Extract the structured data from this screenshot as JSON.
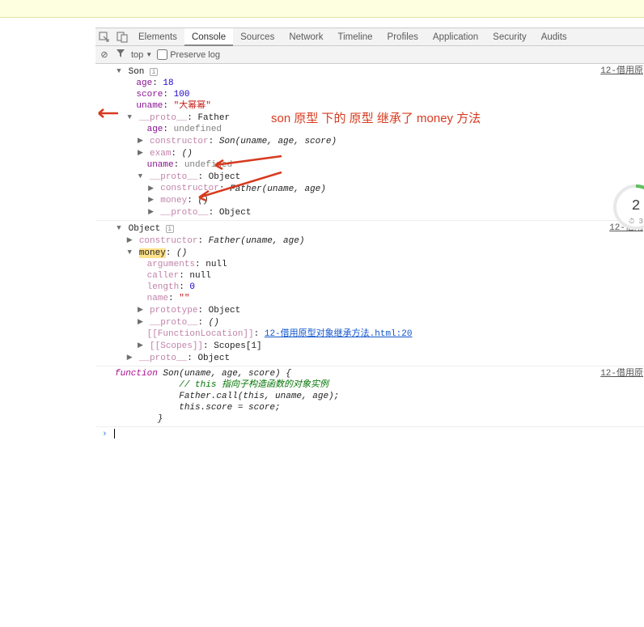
{
  "topbar": {},
  "tabs": {
    "inspect_icon": "inspect",
    "device_icon": "device",
    "items": [
      "Elements",
      "Console",
      "Sources",
      "Network",
      "Timeline",
      "Profiles",
      "Application",
      "Security",
      "Audits"
    ],
    "active": "Console"
  },
  "filterbar": {
    "clear_icon": "⊘",
    "context": "top",
    "preserve_label": "Preserve log"
  },
  "annotation": {
    "text": "son   原型 下的 原型 继承了   money 方法"
  },
  "entries": [
    {
      "srclink": "12-借用原",
      "tree": {
        "root": "Son",
        "lines": [
          {
            "indent": 1,
            "arrow": "down",
            "prop": "",
            "text": "Son",
            "trail": ""
          },
          {
            "indent": 2,
            "prop": "age",
            "val_num": "18"
          },
          {
            "indent": 2,
            "prop": "score",
            "val_num": "100"
          },
          {
            "indent": 2,
            "prop": "uname",
            "val_str": "\"大幂幂\""
          },
          {
            "indent": 2,
            "arrow": "down",
            "prop_f": "__proto__",
            "val_obj": "Father"
          },
          {
            "indent": 3,
            "prop": "age",
            "val_undef": "undefined"
          },
          {
            "indent": 3,
            "arrow": "right",
            "prop_f": "constructor",
            "val_fn": "Son(uname, age, score)"
          },
          {
            "indent": 3,
            "arrow": "right",
            "prop_f": "exam",
            "val_fn": "()"
          },
          {
            "indent": 3,
            "prop": "uname",
            "val_undef": "undefined"
          },
          {
            "indent": 3,
            "arrow": "down",
            "prop_f": "__proto__",
            "val_obj": "Object"
          },
          {
            "indent": 4,
            "arrow": "right",
            "prop_f": "constructor",
            "val_fn": "Father(uname, age)"
          },
          {
            "indent": 4,
            "arrow": "right",
            "prop_f": "money",
            "val_fn": "()"
          },
          {
            "indent": 4,
            "arrow": "right",
            "prop_f": "__proto__",
            "val_obj": "Object"
          }
        ]
      }
    },
    {
      "srclink": "12-借用",
      "tree": {
        "lines": [
          {
            "indent": 0,
            "arrow": "down",
            "prop": "",
            "text": "Object",
            "trail": ""
          },
          {
            "indent": 1,
            "arrow": "right",
            "prop_f": "constructor",
            "val_fn": "Father(uname, age)"
          },
          {
            "indent": 1,
            "arrow": "down",
            "prop_hl": "money",
            "val_fn": "()"
          },
          {
            "indent": 2,
            "prop_f": "arguments",
            "val_obj": "null"
          },
          {
            "indent": 2,
            "prop_f": "caller",
            "val_obj": "null"
          },
          {
            "indent": 2,
            "prop_f": "length",
            "val_num": "0"
          },
          {
            "indent": 2,
            "prop_f": "name",
            "val_str": "\"\""
          },
          {
            "indent": 2,
            "arrow": "right",
            "prop_f": "prototype",
            "val_obj": "Object"
          },
          {
            "indent": 2,
            "arrow": "right",
            "prop_f": "__proto__",
            "val_fn": "()"
          },
          {
            "indent": 2,
            "prop_f": "[[FunctionLocation]]",
            "link": "12-借用原型对象继承方法.html:20"
          },
          {
            "indent": 2,
            "arrow": "right",
            "prop_f": "[[Scopes]]",
            "val_obj": "Scopes[1]"
          },
          {
            "indent": 1,
            "arrow": "right",
            "prop_f": "__proto__",
            "val_obj": "Object"
          }
        ]
      }
    },
    {
      "srclink": "12-借用原",
      "code": [
        {
          "t": "function ",
          "cls": "kw"
        },
        {
          "t": "Son(uname, age, score) {",
          "cls": "fn"
        },
        {
          "br": true
        },
        {
          "t": "            // this 指向子构造函数的对象实例",
          "cls": "comment"
        },
        {
          "br": true
        },
        {
          "t": "            Father.call(this, uname, age);",
          "cls": "fn"
        },
        {
          "br": true
        },
        {
          "t": "            this.score = score;",
          "cls": "fn"
        },
        {
          "br": true
        },
        {
          "t": "        }",
          "cls": "fn"
        }
      ]
    }
  ],
  "gauge": {
    "value": "2",
    "sub": "3"
  }
}
